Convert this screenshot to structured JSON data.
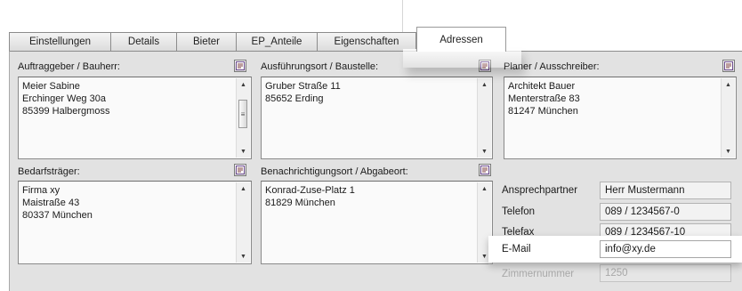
{
  "tabs": [
    {
      "label": "Einstellungen",
      "active": false
    },
    {
      "label": "Details",
      "active": false
    },
    {
      "label": "Bieter",
      "active": false
    },
    {
      "label": "EP_Anteile",
      "active": false
    },
    {
      "label": "Eigenschaften",
      "active": false
    },
    {
      "label": "Adressen",
      "active": true
    }
  ],
  "address_fields": [
    {
      "label": "Auftraggeber / Bauherr:",
      "lines": [
        "Meier  Sabine",
        "Erchinger Weg 30a",
        "85399 Halbergmoss"
      ]
    },
    {
      "label": "Ausführungsort / Baustelle:",
      "lines": [
        "Gruber Straße 11",
        "85652 Erding"
      ]
    },
    {
      "label": "Planer / Ausschreiber:",
      "lines": [
        "Architekt Bauer",
        "Menterstraße 83",
        "81247 München"
      ]
    },
    {
      "label": "Bedarfsträger:",
      "lines": [
        "Firma xy",
        "Maistraße 43",
        "80337 München"
      ]
    },
    {
      "label": "Benachrichtigungsort / Abgabeort:",
      "lines": [
        "Konrad-Zuse-Platz 1",
        "81829 München"
      ]
    }
  ],
  "contact": [
    {
      "label": "Ansprechpartner",
      "value": "Herr Mustermann"
    },
    {
      "label": "Telefon",
      "value": "089 / 1234567-0"
    },
    {
      "label": "Telefax",
      "value": "089 / 1234567-10"
    },
    {
      "label": "E-Mail",
      "value": "info@xy.de"
    },
    {
      "label": "Zimmernummer",
      "value": "1250"
    }
  ],
  "icons": {
    "edit": "edit-note-icon",
    "scroll_up": "scroll-up-arrow-icon",
    "scroll_down": "scroll-down-arrow-icon"
  }
}
